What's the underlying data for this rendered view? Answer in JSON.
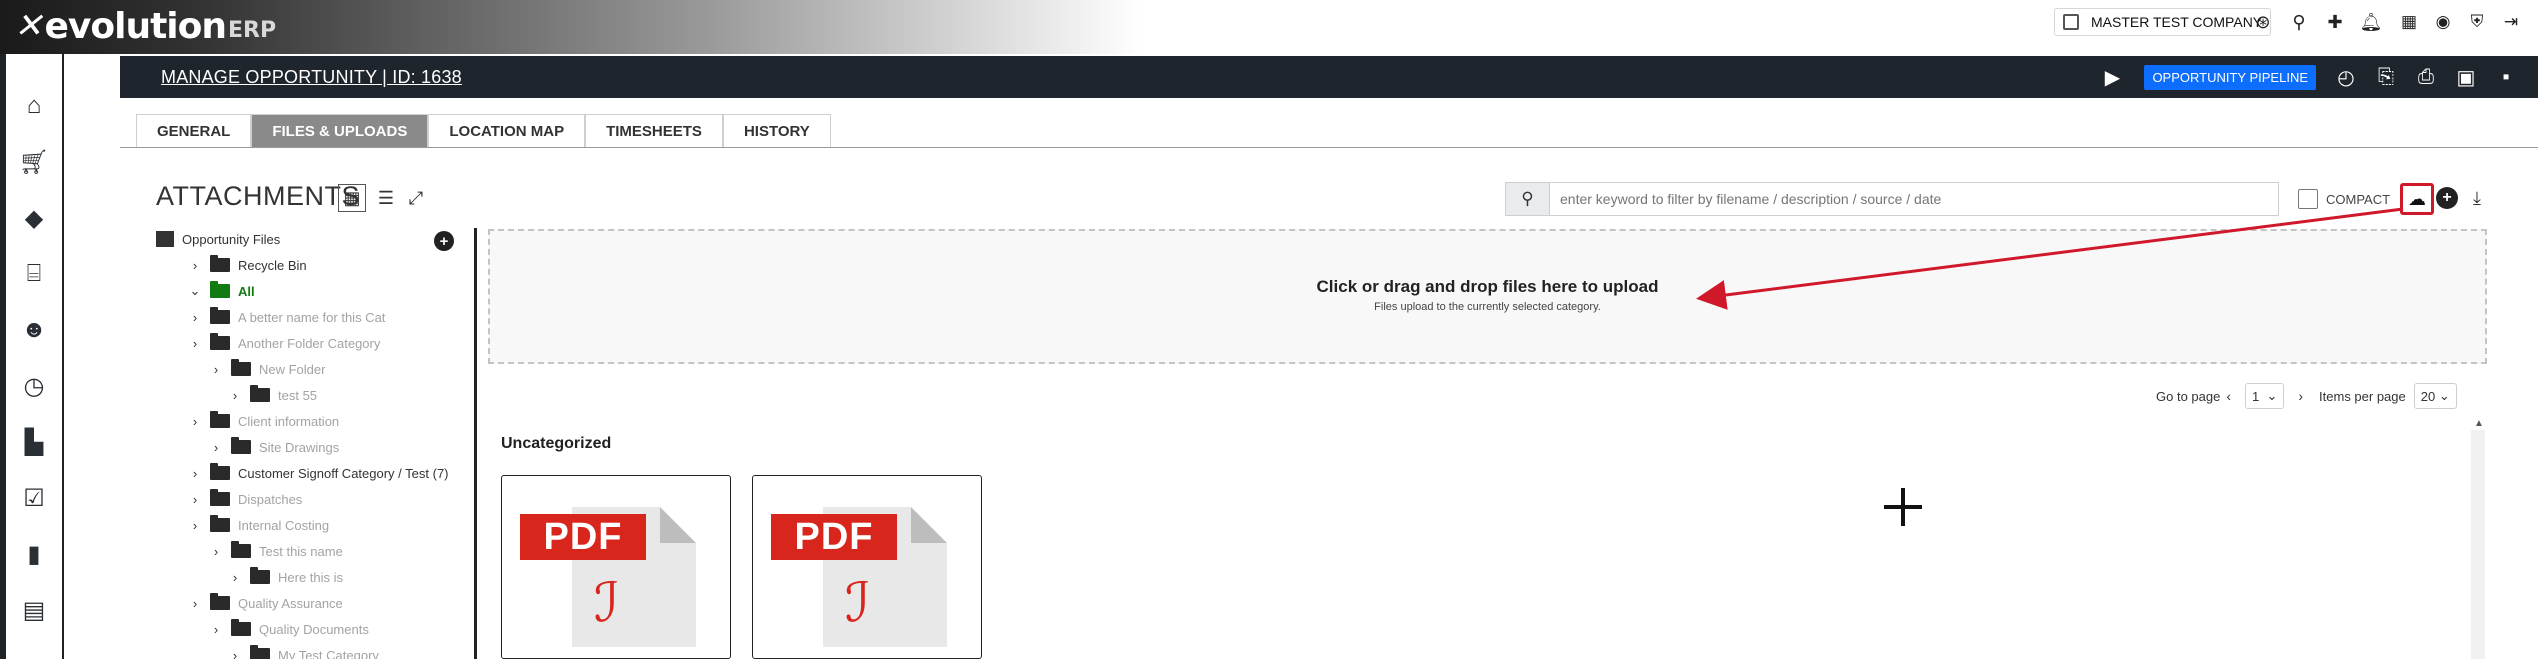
{
  "brand": {
    "mark": "✕",
    "word": "evolution",
    "suffix": "ERP"
  },
  "topbar": {
    "company": "MASTER TEST COMPANY",
    "icons": [
      "lifebuoy-icon",
      "search-icon",
      "puzzle-icon",
      "bell-icon",
      "calendar-icon",
      "user-icon",
      "shield-icon",
      "logout-icon"
    ]
  },
  "leftnav": {
    "items": [
      "home-icon",
      "cart-icon",
      "tag-icon",
      "bank-icon",
      "user-settings-icon",
      "clock-icon",
      "factory-icon",
      "clipboard-check-icon",
      "bar-chart-icon",
      "building-truck-icon"
    ]
  },
  "header": {
    "title": "MANAGE OPPORTUNITY | ID: 1638",
    "pipeline_label": "OPPORTUNITY PIPELINE"
  },
  "tabs": [
    {
      "label": "GENERAL",
      "active": false
    },
    {
      "label": "FILES & UPLOADS",
      "active": true
    },
    {
      "label": "LOCATION MAP",
      "active": false
    },
    {
      "label": "TIMESHEETS",
      "active": false
    },
    {
      "label": "HISTORY",
      "active": false
    }
  ],
  "attachments": {
    "title": "ATTACHMENTS",
    "search_placeholder": "enter keyword to filter by filename / description / source / date",
    "compact_label": "COMPACT"
  },
  "tree": [
    {
      "label": "Opportunity Files",
      "level": 0,
      "type": "root"
    },
    {
      "label": "Recycle Bin",
      "level": 1,
      "type": "bin"
    },
    {
      "label": "All",
      "level": 1,
      "type": "folder",
      "state": "green"
    },
    {
      "label": "A better name for this Cat",
      "level": 1,
      "type": "folder",
      "state": "dim"
    },
    {
      "label": "Another Folder Category",
      "level": 1,
      "type": "folder",
      "state": "dim"
    },
    {
      "label": "New Folder",
      "level": 2,
      "type": "folder",
      "state": "dim"
    },
    {
      "label": "test 55",
      "level": 3,
      "type": "folder",
      "state": "dim"
    },
    {
      "label": "Client information",
      "level": 1,
      "type": "folder",
      "state": "dim"
    },
    {
      "label": "Site Drawings",
      "level": 2,
      "type": "folder",
      "state": "dim"
    },
    {
      "label": "Customer Signoff Category / Test (7)",
      "level": 1,
      "type": "folder",
      "state": "normal"
    },
    {
      "label": "Dispatches",
      "level": 1,
      "type": "folder",
      "state": "dim"
    },
    {
      "label": "Internal Costing",
      "level": 1,
      "type": "folder",
      "state": "dim"
    },
    {
      "label": "Test this name",
      "level": 2,
      "type": "folder",
      "state": "dim"
    },
    {
      "label": "Here this is",
      "level": 3,
      "type": "folder",
      "state": "dim"
    },
    {
      "label": "Quality Assurance",
      "level": 1,
      "type": "folder",
      "state": "dim"
    },
    {
      "label": "Quality Documents",
      "level": 2,
      "type": "folder",
      "state": "dim"
    },
    {
      "label": "My Test Category",
      "level": 3,
      "type": "folder",
      "state": "dim"
    }
  ],
  "dropzone": {
    "title": "Click or drag and drop files here to upload",
    "subtitle": "Files upload to the currently selected category."
  },
  "pager": {
    "goto_label": "Go to page",
    "page": "1",
    "per_page_label": "Items per page",
    "per_page": "20"
  },
  "section_title": "Uncategorized",
  "files": [
    {
      "badge": "PDF"
    },
    {
      "badge": "PDF"
    }
  ],
  "colors": {
    "accent_red": "#d0182b",
    "pipeline_blue": "#0d6efd",
    "header_dark": "#1f252d",
    "folder_green": "#117a11"
  }
}
